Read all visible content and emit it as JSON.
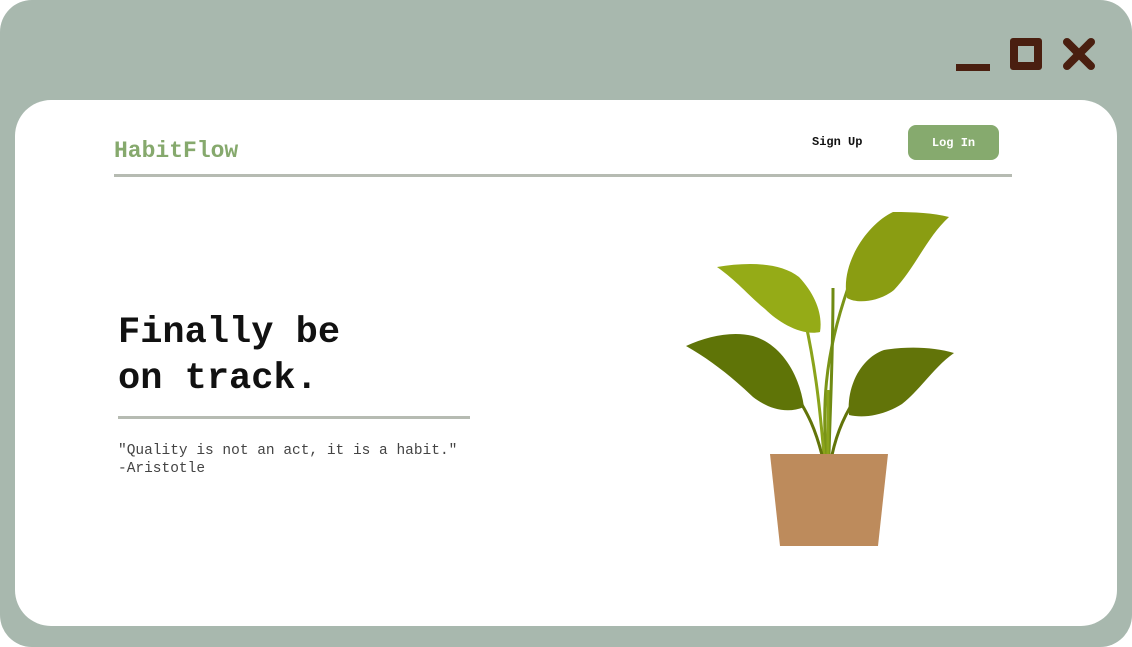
{
  "window": {
    "controls": {
      "minimize_icon": "minimize-icon",
      "maximize_icon": "maximize-icon",
      "close_icon": "close-icon"
    },
    "frame_color": "#a8b8ae",
    "control_color": "#4a1f10"
  },
  "nav": {
    "logo": "HabitFlow",
    "signup_label": "Sign Up",
    "login_label": "Log In"
  },
  "hero": {
    "title_line1": "Finally be",
    "title_line2": "on track.",
    "quote_line1": "\"Quality is not an act, it is a habit.\"",
    "quote_line2": "-Aristotle"
  },
  "illustration": {
    "name": "potted-plant-illustration",
    "pot_color": "#bd8b5c",
    "leaf_colors": [
      "#8a9d12",
      "#95ab17",
      "#5f7407",
      "#627409",
      "#6c8a1a"
    ]
  },
  "theme": {
    "accent": "#86aa6e",
    "divider": "#b6bbb2"
  }
}
